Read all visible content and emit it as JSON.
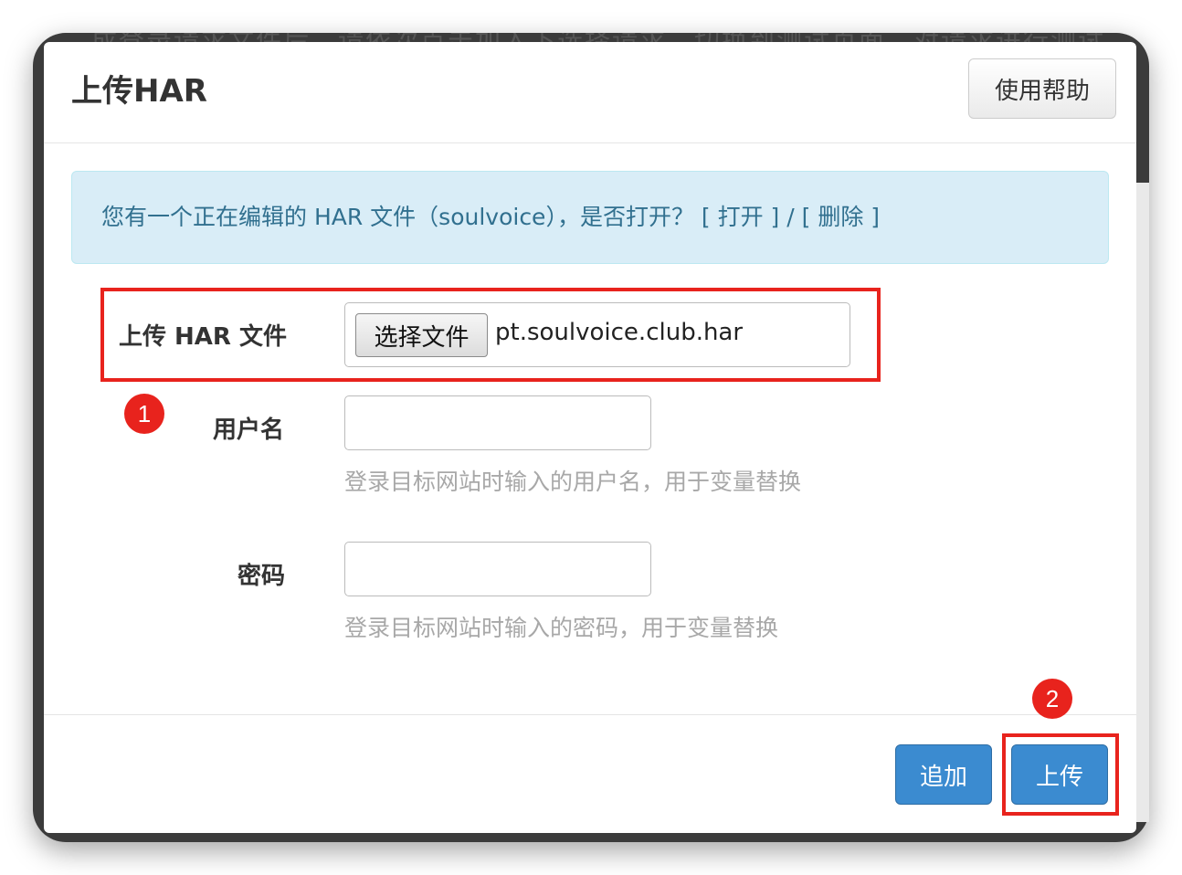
{
  "modal": {
    "title": "上传HAR",
    "help_button": "使用帮助"
  },
  "backdrop": {
    "partial_text": "成登录请求文件后，请依次点击加入下选择请求，切换到测试页面，对请求进行测试"
  },
  "alert": {
    "prefix": "您有一个正在编辑的 HAR 文件（soulvoice），是否打开？",
    "open_link": "[ 打开 ]",
    "separator": " / ",
    "delete_link": "[ 删除 ]"
  },
  "form": {
    "file": {
      "label": "上传 HAR 文件",
      "choose_button": "选择文件",
      "file_name": "pt.soulvoice.club.har"
    },
    "username": {
      "label": "用户名",
      "value": "",
      "help": "登录目标网站时输入的用户名，用于变量替换"
    },
    "password": {
      "label": "密码",
      "value": "",
      "help": "登录目标网站时输入的密码，用于变量替换"
    }
  },
  "footer": {
    "append_button": "追加",
    "upload_button": "上传"
  },
  "annotations": {
    "marker_1": "1",
    "marker_2": "2",
    "highlight_color": "#e8231d"
  },
  "colors": {
    "primary": "#3b8bd0",
    "alert_bg": "#d9edf7",
    "alert_text": "#31708f"
  }
}
